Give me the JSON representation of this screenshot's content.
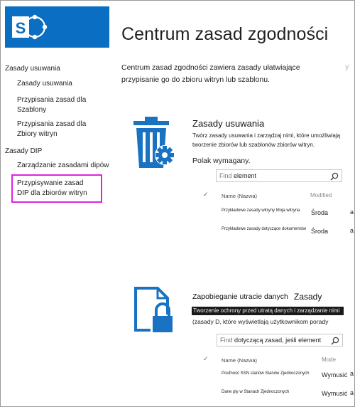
{
  "page": {
    "title": "Centrum zasad zgodności",
    "description": "Centrum zasad zgodności zawiera zasady ułatwiające przypisanie go do zbioru witryn lub szablonu.",
    "edge_text": "y"
  },
  "nav": {
    "items": [
      {
        "label": "Zasady usuwania",
        "level": "group"
      },
      {
        "label": "Zasady usuwania",
        "level": "sub"
      },
      {
        "label": "Przypisania zasad dla",
        "label2": "Szablony",
        "level": "sub"
      },
      {
        "label": "Przypisania zasad dla",
        "label2": "Zbiory witryn",
        "level": "sub"
      },
      {
        "label": "Zasady DIP",
        "level": "group"
      },
      {
        "label": "Zarządzanie zasadami dipów",
        "level": "sub"
      },
      {
        "label": "Przypisywanie zasad",
        "label2": "DIP dla zbiorów witryn",
        "level": "sub",
        "highlighted": true
      }
    ]
  },
  "section1": {
    "title": "Zasady usuwania",
    "description": "Twórz zasady usuwania i zarządzaj nimi, które umożliwiają tworzenie zbiorów lub szablonów zbiorów witryn.",
    "required": "Polak wymagany.",
    "search": {
      "find_label": "Find",
      "query": "element"
    },
    "columns": {
      "check": "✓",
      "name": "Name (Nazwa)",
      "modified": "Modified"
    },
    "rows": [
      {
        "name": "Przykładowe zasady witryny Moja witryna",
        "value": "Środa",
        "extra": "a"
      },
      {
        "name": "Przykładowe zasady dotyczące dokumentów",
        "value": "Środa",
        "extra": "a"
      }
    ]
  },
  "section2": {
    "title": "Zapobieganie utracie danych",
    "title2": "Zasady",
    "highlight_line": "Tworzenie ochrony przed utratą danych i zarządzanie nimi",
    "description": "(zasady D, które wyświetlają użytkownikom porady",
    "search": {
      "find_label": "Find",
      "query": "dotyczącą zasad, jeśli element"
    },
    "columns": {
      "check": "✓",
      "name": "Name (Nazwa)",
      "mode": "Mode"
    },
    "rows": [
      {
        "name": "Poufność SSN stanów Stanów Zjednoczonych",
        "value": "Wymusić",
        "extra": "a"
      },
      {
        "name": "Dane ply w Stanach Zjednoczonych",
        "value": "Wymusić",
        "extra": "a"
      }
    ]
  },
  "colors": {
    "brand_blue": "#0a6fc2",
    "highlight_magenta": "#e022e0",
    "black_bar": "#1a1a1a"
  },
  "icons": [
    "sharepoint-logo-icon",
    "recycle-bin-gear-icon",
    "document-lock-icon",
    "search-icon"
  ]
}
